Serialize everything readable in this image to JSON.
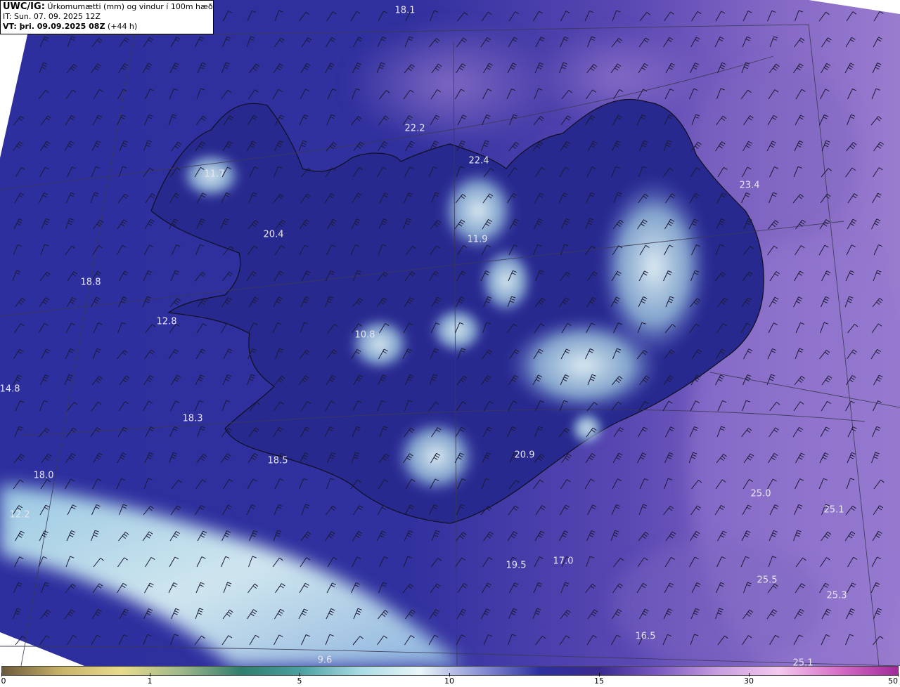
{
  "header": {
    "model": "UWC/IG:",
    "title": " Úrkomumætti (mm) og vindur í 100m hæð",
    "initial_time": "IT: Sun. 07. 09. 2025 12Z",
    "valid_time_label": "VT: þri. 09.09.2025 08Z",
    "lead": " (+44 h)"
  },
  "colors": {
    "ocean_base": "#2c2d9c",
    "east_purple": "#8a6cc7",
    "pale_precip": "#cfe9ee",
    "coastline": "#111111",
    "barb": "#1a1a33"
  },
  "map_labels": [
    {
      "id": "v1",
      "text": "18.1"
    },
    {
      "id": "v2",
      "text": "22.2"
    },
    {
      "id": "v3",
      "text": "22.4"
    },
    {
      "id": "v4",
      "text": "11.7"
    },
    {
      "id": "v5",
      "text": "23.4"
    },
    {
      "id": "v6",
      "text": "20.4"
    },
    {
      "id": "v7",
      "text": "11.9"
    },
    {
      "id": "v8",
      "text": "18.8"
    },
    {
      "id": "v9",
      "text": "12.8"
    },
    {
      "id": "v10",
      "text": "10.8"
    },
    {
      "id": "v11",
      "text": "14.8"
    },
    {
      "id": "v12",
      "text": "18.3"
    },
    {
      "id": "v13",
      "text": "18.5"
    },
    {
      "id": "v14",
      "text": "20.9"
    },
    {
      "id": "v15",
      "text": "18.0"
    },
    {
      "id": "v16",
      "text": "12.2"
    },
    {
      "id": "v17",
      "text": "25.0"
    },
    {
      "id": "v18",
      "text": "25.1"
    },
    {
      "id": "v19",
      "text": "19.5"
    },
    {
      "id": "v20",
      "text": "17.0"
    },
    {
      "id": "v21",
      "text": "25.5"
    },
    {
      "id": "v22",
      "text": "25.3"
    },
    {
      "id": "v23",
      "text": "16.5"
    },
    {
      "id": "v24",
      "text": "9.6"
    },
    {
      "id": "v25",
      "text": "25.1"
    }
  ],
  "colorbar": {
    "ticks": [
      "0",
      "1",
      "5",
      "10",
      "15",
      "30",
      "50"
    ],
    "stops": [
      "#6b5a3a",
      "#c9b36a",
      "#e8dc8c",
      "#9fb78a",
      "#2f7d6d",
      "#4aa0a0",
      "#a9dbe4",
      "#e9f6f8",
      "#8c93d6",
      "#2d2f9f",
      "#3a2a8f",
      "#7b5ac2",
      "#c89fe0",
      "#f4c8ee",
      "#d86fc8",
      "#a12a9a"
    ]
  }
}
